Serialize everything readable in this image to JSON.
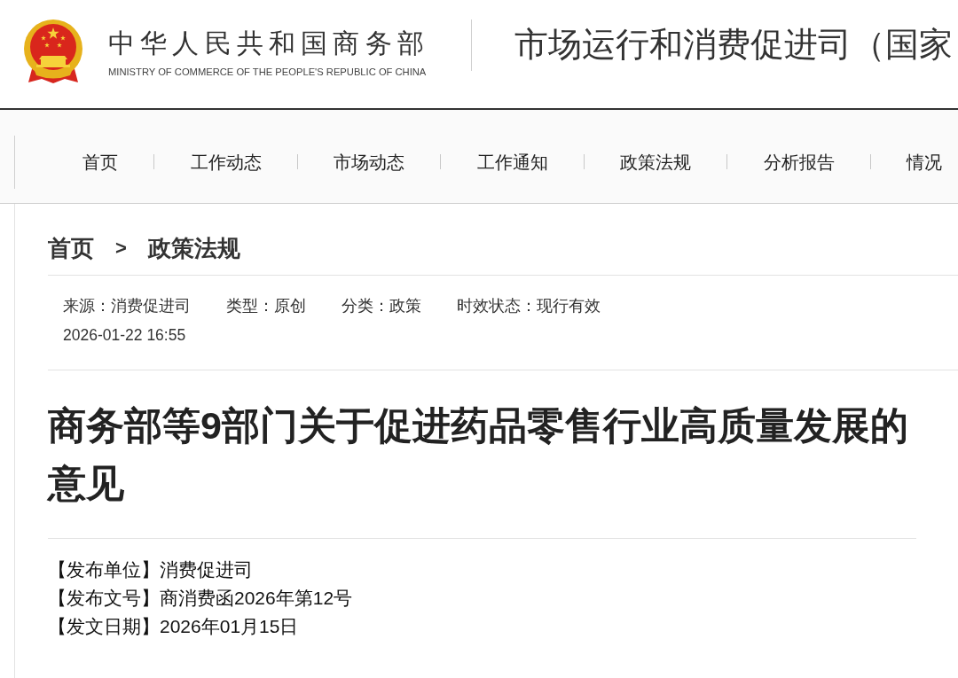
{
  "header": {
    "ministry_name": "中华人民共和国商务部",
    "ministry_name_english": "MINISTRY OF COMMERCE OF THE PEOPLE'S REPUBLIC OF CHINA",
    "department_title": "市场运行和消费促进司（国家"
  },
  "nav": {
    "items": [
      "首页",
      "工作动态",
      "市场动态",
      "工作通知",
      "政策法规",
      "分析报告",
      "情况"
    ]
  },
  "breadcrumb": {
    "items": [
      "首页",
      "政策法规"
    ],
    "separator": ">"
  },
  "meta": {
    "fields": [
      "来源：消费促进司",
      "类型：原创",
      "分类：政策",
      "时效状态：现行有效"
    ],
    "published_at": "2026-01-22 16:55"
  },
  "article": {
    "title": "商务部等9部门关于促进药品零售行业高质量发展的意见",
    "info_lines": [
      "【发布单位】消费促进司",
      "【发布文号】商消费函2026年第12号",
      "【发文日期】2026年01月15日"
    ]
  }
}
